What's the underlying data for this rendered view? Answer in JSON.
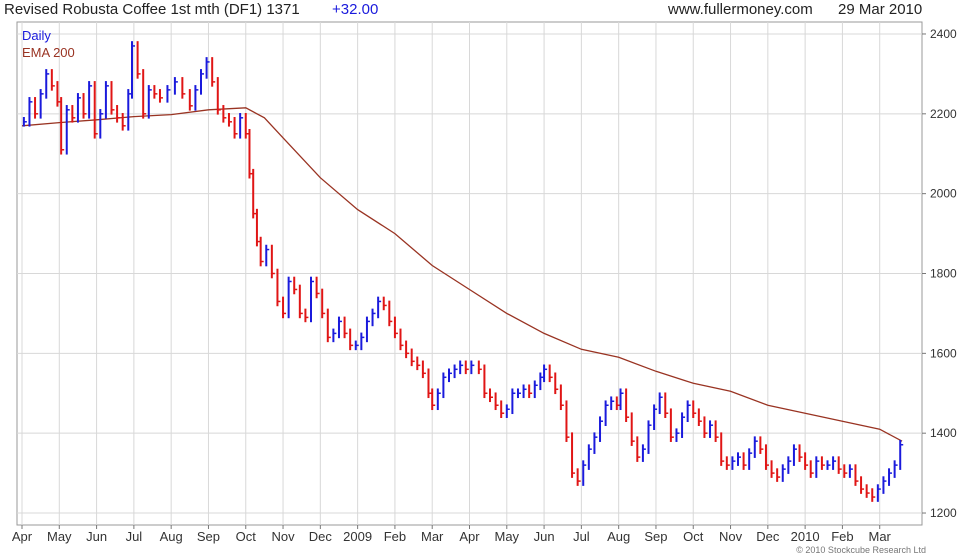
{
  "header": {
    "title": "Revised Robusta Coffee 1st mth (DF1) 1371",
    "change": "+32.00",
    "site": "www.fullermoney.com",
    "date": "29 Mar 2010"
  },
  "footer": {
    "copyright": "© 2010 Stockcube Research Ltd"
  },
  "colors": {
    "up": "#1a1adc",
    "down": "#e01515",
    "ema": "#993322",
    "change": "#1a1adc",
    "grid": "#d8d8d8"
  },
  "chart_data": {
    "type": "line",
    "title": "Revised Robusta Coffee 1st mth (DF1) 1371",
    "legend": [
      "Daily",
      "EMA 200"
    ],
    "legend_position": "top-left",
    "grid": true,
    "y_axis_position": "right",
    "ylim": [
      1170,
      2430
    ],
    "y_ticks": [
      1200,
      1400,
      1600,
      1800,
      2000,
      2200,
      2400
    ],
    "xlim": [
      0,
      24
    ],
    "x_ticks": [
      {
        "t": 0.0,
        "label": "Apr"
      },
      {
        "t": 1.0,
        "label": "May"
      },
      {
        "t": 2.0,
        "label": "Jun"
      },
      {
        "t": 3.0,
        "label": "Jul"
      },
      {
        "t": 4.0,
        "label": "Aug"
      },
      {
        "t": 5.0,
        "label": "Sep"
      },
      {
        "t": 6.0,
        "label": "Oct"
      },
      {
        "t": 7.0,
        "label": "Nov"
      },
      {
        "t": 8.0,
        "label": "Dec"
      },
      {
        "t": 9.0,
        "label": "2009"
      },
      {
        "t": 10.0,
        "label": "Feb"
      },
      {
        "t": 11.0,
        "label": "Mar"
      },
      {
        "t": 12.0,
        "label": "Apr"
      },
      {
        "t": 13.0,
        "label": "May"
      },
      {
        "t": 14.0,
        "label": "Jun"
      },
      {
        "t": 15.0,
        "label": "Jul"
      },
      {
        "t": 16.0,
        "label": "Aug"
      },
      {
        "t": 17.0,
        "label": "Sep"
      },
      {
        "t": 18.0,
        "label": "Oct"
      },
      {
        "t": 19.0,
        "label": "Nov"
      },
      {
        "t": 20.0,
        "label": "Dec"
      },
      {
        "t": 21.0,
        "label": "2010"
      },
      {
        "t": 22.0,
        "label": "Feb"
      },
      {
        "t": 23.0,
        "label": "Mar"
      }
    ],
    "series": [
      {
        "name": "Daily",
        "style": "daily-bars",
        "points": [
          [
            0.05,
            2180
          ],
          [
            0.2,
            2230
          ],
          [
            0.35,
            2200
          ],
          [
            0.5,
            2250
          ],
          [
            0.65,
            2300
          ],
          [
            0.8,
            2270
          ],
          [
            0.95,
            2230
          ],
          [
            1.05,
            2110
          ],
          [
            1.2,
            2210
          ],
          [
            1.35,
            2190
          ],
          [
            1.5,
            2240
          ],
          [
            1.65,
            2200
          ],
          [
            1.8,
            2270
          ],
          [
            1.95,
            2150
          ],
          [
            2.1,
            2200
          ],
          [
            2.25,
            2270
          ],
          [
            2.4,
            2210
          ],
          [
            2.55,
            2190
          ],
          [
            2.7,
            2170
          ],
          [
            2.85,
            2250
          ],
          [
            2.95,
            2370
          ],
          [
            3.1,
            2300
          ],
          [
            3.25,
            2200
          ],
          [
            3.4,
            2260
          ],
          [
            3.55,
            2250
          ],
          [
            3.7,
            2240
          ],
          [
            3.9,
            2260
          ],
          [
            4.1,
            2280
          ],
          [
            4.3,
            2250
          ],
          [
            4.5,
            2220
          ],
          [
            4.65,
            2260
          ],
          [
            4.8,
            2300
          ],
          [
            4.95,
            2330
          ],
          [
            5.1,
            2280
          ],
          [
            5.25,
            2210
          ],
          [
            5.4,
            2190
          ],
          [
            5.55,
            2180
          ],
          [
            5.7,
            2150
          ],
          [
            5.85,
            2190
          ],
          [
            6.0,
            2150
          ],
          [
            6.1,
            2050
          ],
          [
            6.2,
            1950
          ],
          [
            6.3,
            1880
          ],
          [
            6.4,
            1830
          ],
          [
            6.55,
            1860
          ],
          [
            6.7,
            1800
          ],
          [
            6.85,
            1730
          ],
          [
            7.0,
            1700
          ],
          [
            7.15,
            1780
          ],
          [
            7.3,
            1760
          ],
          [
            7.45,
            1700
          ],
          [
            7.6,
            1690
          ],
          [
            7.75,
            1780
          ],
          [
            7.9,
            1750
          ],
          [
            8.05,
            1700
          ],
          [
            8.2,
            1640
          ],
          [
            8.35,
            1650
          ],
          [
            8.5,
            1680
          ],
          [
            8.65,
            1650
          ],
          [
            8.8,
            1620
          ],
          [
            8.95,
            1620
          ],
          [
            9.1,
            1640
          ],
          [
            9.25,
            1680
          ],
          [
            9.4,
            1700
          ],
          [
            9.55,
            1730
          ],
          [
            9.7,
            1720
          ],
          [
            9.85,
            1680
          ],
          [
            10.0,
            1650
          ],
          [
            10.15,
            1620
          ],
          [
            10.3,
            1600
          ],
          [
            10.45,
            1580
          ],
          [
            10.6,
            1570
          ],
          [
            10.75,
            1550
          ],
          [
            10.9,
            1500
          ],
          [
            11.0,
            1470
          ],
          [
            11.15,
            1500
          ],
          [
            11.3,
            1540
          ],
          [
            11.45,
            1550
          ],
          [
            11.6,
            1560
          ],
          [
            11.75,
            1570
          ],
          [
            11.9,
            1560
          ],
          [
            12.05,
            1570
          ],
          [
            12.25,
            1560
          ],
          [
            12.4,
            1500
          ],
          [
            12.55,
            1490
          ],
          [
            12.7,
            1470
          ],
          [
            12.85,
            1450
          ],
          [
            13.0,
            1460
          ],
          [
            13.15,
            1500
          ],
          [
            13.3,
            1500
          ],
          [
            13.45,
            1510
          ],
          [
            13.6,
            1500
          ],
          [
            13.75,
            1520
          ],
          [
            13.9,
            1540
          ],
          [
            14.0,
            1560
          ],
          [
            14.15,
            1540
          ],
          [
            14.3,
            1510
          ],
          [
            14.45,
            1470
          ],
          [
            14.6,
            1390
          ],
          [
            14.75,
            1300
          ],
          [
            14.9,
            1280
          ],
          [
            15.05,
            1320
          ],
          [
            15.2,
            1360
          ],
          [
            15.35,
            1390
          ],
          [
            15.5,
            1430
          ],
          [
            15.65,
            1470
          ],
          [
            15.8,
            1480
          ],
          [
            15.95,
            1470
          ],
          [
            16.05,
            1500
          ],
          [
            16.2,
            1440
          ],
          [
            16.35,
            1380
          ],
          [
            16.5,
            1340
          ],
          [
            16.65,
            1360
          ],
          [
            16.8,
            1420
          ],
          [
            16.95,
            1460
          ],
          [
            17.1,
            1490
          ],
          [
            17.25,
            1450
          ],
          [
            17.4,
            1390
          ],
          [
            17.55,
            1400
          ],
          [
            17.7,
            1440
          ],
          [
            17.85,
            1470
          ],
          [
            18.0,
            1450
          ],
          [
            18.15,
            1430
          ],
          [
            18.3,
            1400
          ],
          [
            18.45,
            1420
          ],
          [
            18.6,
            1390
          ],
          [
            18.75,
            1330
          ],
          [
            18.9,
            1320
          ],
          [
            19.05,
            1330
          ],
          [
            19.2,
            1340
          ],
          [
            19.35,
            1320
          ],
          [
            19.5,
            1350
          ],
          [
            19.65,
            1380
          ],
          [
            19.8,
            1360
          ],
          [
            19.95,
            1320
          ],
          [
            20.1,
            1300
          ],
          [
            20.25,
            1290
          ],
          [
            20.4,
            1310
          ],
          [
            20.55,
            1330
          ],
          [
            20.7,
            1360
          ],
          [
            20.85,
            1340
          ],
          [
            21.0,
            1320
          ],
          [
            21.15,
            1300
          ],
          [
            21.3,
            1330
          ],
          [
            21.45,
            1320
          ],
          [
            21.6,
            1320
          ],
          [
            21.75,
            1330
          ],
          [
            21.9,
            1310
          ],
          [
            22.05,
            1300
          ],
          [
            22.2,
            1310
          ],
          [
            22.35,
            1280
          ],
          [
            22.5,
            1260
          ],
          [
            22.65,
            1250
          ],
          [
            22.8,
            1240
          ],
          [
            22.95,
            1260
          ],
          [
            23.1,
            1280
          ],
          [
            23.25,
            1300
          ],
          [
            23.4,
            1320
          ],
          [
            23.55,
            1371
          ]
        ]
      },
      {
        "name": "EMA 200",
        "style": "line",
        "points": [
          [
            0.0,
            2170
          ],
          [
            1.0,
            2178
          ],
          [
            2.0,
            2185
          ],
          [
            3.0,
            2193
          ],
          [
            4.0,
            2198
          ],
          [
            5.0,
            2210
          ],
          [
            6.0,
            2215
          ],
          [
            6.5,
            2190
          ],
          [
            7.0,
            2140
          ],
          [
            8.0,
            2040
          ],
          [
            9.0,
            1960
          ],
          [
            10.0,
            1900
          ],
          [
            11.0,
            1820
          ],
          [
            12.0,
            1760
          ],
          [
            13.0,
            1700
          ],
          [
            14.0,
            1650
          ],
          [
            15.0,
            1610
          ],
          [
            16.0,
            1590
          ],
          [
            17.0,
            1555
          ],
          [
            18.0,
            1525
          ],
          [
            19.0,
            1505
          ],
          [
            20.0,
            1470
          ],
          [
            21.0,
            1450
          ],
          [
            22.0,
            1430
          ],
          [
            23.0,
            1410
          ],
          [
            23.6,
            1380
          ]
        ]
      }
    ]
  }
}
